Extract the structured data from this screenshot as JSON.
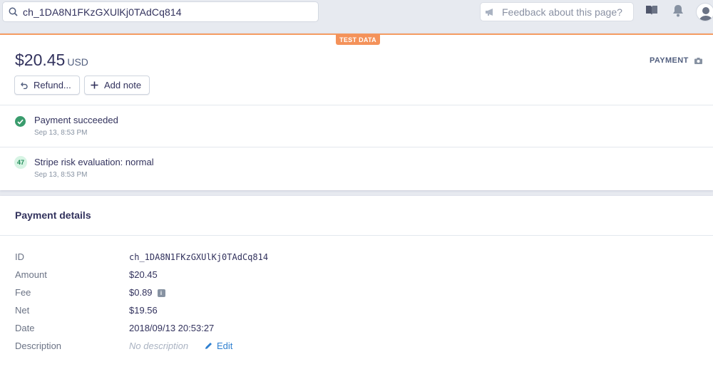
{
  "search": {
    "value": "ch_1DA8N1FKzGXUlKj0TAdCq814"
  },
  "feedback": {
    "placeholder": "Feedback about this page?"
  },
  "banner": {
    "test_data": "TEST DATA"
  },
  "payment": {
    "amount": "$20.45",
    "currency": "USD",
    "type_label": "PAYMENT",
    "refund_label": "Refund...",
    "add_note_label": "Add note"
  },
  "timeline": [
    {
      "title": "Payment succeeded",
      "time": "Sep 13, 8:53 PM"
    },
    {
      "badge": "47",
      "title": "Stripe risk evaluation: normal",
      "time": "Sep 13, 8:53 PM"
    }
  ],
  "details": {
    "heading": "Payment details",
    "rows": [
      {
        "label": "ID",
        "value": "ch_1DA8N1FKzGXUlKj0TAdCq814"
      },
      {
        "label": "Amount",
        "value": "$20.45"
      },
      {
        "label": "Fee",
        "value": "$0.89"
      },
      {
        "label": "Net",
        "value": "$19.56"
      },
      {
        "label": "Date",
        "value": "2018/09/13 20:53:27"
      },
      {
        "label": "Description",
        "value": "No description",
        "action": "Edit"
      }
    ]
  },
  "colors": {
    "accent": "#2e7fd0",
    "success": "#3a9c6d",
    "test_banner": "#f4925a",
    "text": "#32325d"
  },
  "icons": [
    "search-icon",
    "megaphone-icon",
    "book-icon",
    "bell-icon",
    "user-icon",
    "camera-icon",
    "undo-icon",
    "plus-icon",
    "check-circle-icon",
    "info-icon",
    "pencil-icon"
  ]
}
